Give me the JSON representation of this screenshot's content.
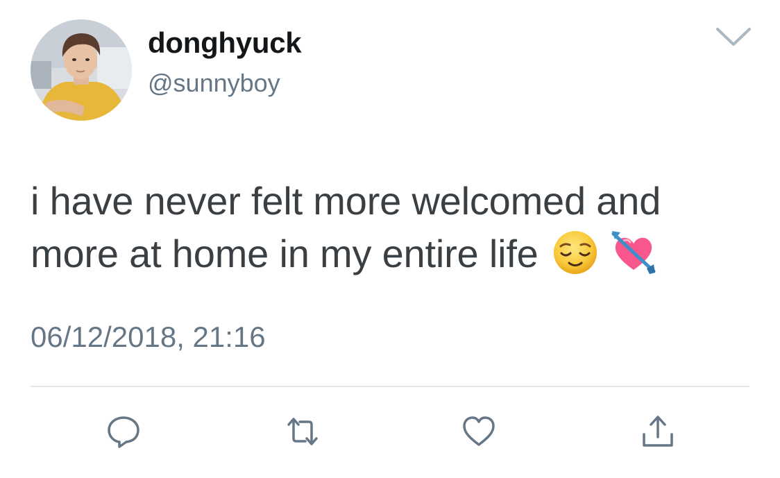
{
  "author": {
    "display_name": "donghyuck",
    "handle": "@sunnyboy"
  },
  "tweet": {
    "text_line_1": "i have never felt more welcomed and",
    "text_line_2": "more at home in my entire life",
    "emoji_1": "relieved-face-emoji",
    "emoji_2": "heart-with-arrow-emoji",
    "timestamp": "06/12/2018, 21:16"
  },
  "actions": [
    "reply-icon",
    "retweet-icon",
    "like-icon",
    "share-icon"
  ],
  "colors": {
    "text_primary": "#14171a",
    "text_secondary": "#657786",
    "icon_gray": "#657786",
    "divider": "#e1e8ed"
  }
}
